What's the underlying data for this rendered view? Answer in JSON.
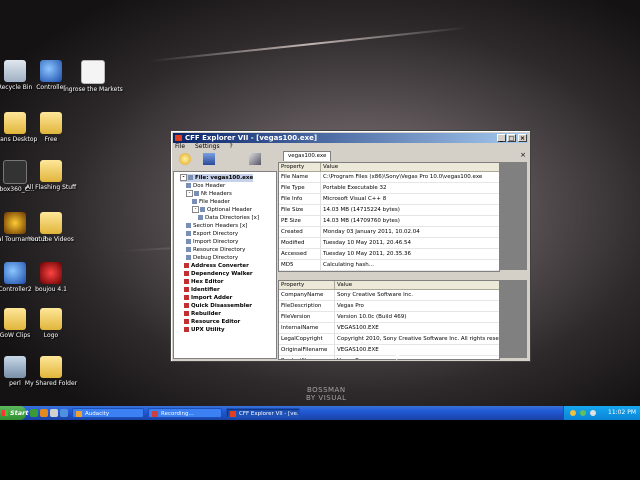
{
  "desktop": {
    "icons": [
      {
        "label": "Recycle Bin",
        "icon": "recycle-bin-icon",
        "cls": "g-bin"
      },
      {
        "label": "Controller",
        "icon": "controller-icon",
        "cls": "g-blue"
      },
      {
        "label": "Ingrose the Markets",
        "icon": "document-icon",
        "cls": "g-file"
      },
      {
        "label": "Seans Desktop",
        "icon": "folder-icon",
        "cls": "g-folder"
      },
      {
        "label": "Free",
        "icon": "folder-icon",
        "cls": "g-folder"
      },
      {
        "label": "Xbox360_C...",
        "icon": "game-icon",
        "cls": "g-dark"
      },
      {
        "label": "All Flashing Stuff",
        "icon": "folder-icon",
        "cls": "g-folder"
      },
      {
        "label": "Unreal Tournament 3",
        "icon": "game-icon",
        "cls": "g-game"
      },
      {
        "label": "Youtube Videos",
        "icon": "folder-icon",
        "cls": "g-folder"
      },
      {
        "label": "Controller2",
        "icon": "controller-icon",
        "cls": "g-blue"
      },
      {
        "label": "boujou 4.1",
        "icon": "boujou-icon",
        "cls": "g-red"
      },
      {
        "label": "GoW Clips",
        "icon": "folder-icon",
        "cls": "g-folder"
      },
      {
        "label": "Logo",
        "icon": "folder-icon",
        "cls": "g-folder"
      },
      {
        "label": "perl",
        "icon": "computer-icon",
        "cls": "g-pc"
      },
      {
        "label": "My Shared Folder",
        "icon": "folder-icon",
        "cls": "g-folder"
      }
    ],
    "watermark_line1": "BOSSMAN",
    "watermark_line2": "BY VISUAL"
  },
  "window": {
    "title": "CFF Explorer VII - [vegas100.exe]",
    "menu": [
      "File",
      "Settings",
      "?"
    ],
    "tab_label": "vegas100.exe",
    "tree": [
      {
        "label": "File: vegas100.exe",
        "bold": true,
        "sel": true
      },
      {
        "label": "Dos Header"
      },
      {
        "label": "Nt Headers"
      },
      {
        "label": "File Header"
      },
      {
        "label": "Optional Header"
      },
      {
        "label": "Data Directories [x]"
      },
      {
        "label": "Section Headers [x]"
      },
      {
        "label": "Export Directory"
      },
      {
        "label": "Import Directory"
      },
      {
        "label": "Resource Directory"
      },
      {
        "label": "Debug Directory"
      },
      {
        "label": "Address Converter",
        "bold": true
      },
      {
        "label": "Dependency Walker",
        "bold": true
      },
      {
        "label": "Hex Editor",
        "bold": true
      },
      {
        "label": "Identifier",
        "bold": true
      },
      {
        "label": "Import Adder",
        "bold": true
      },
      {
        "label": "Quick Disassembler",
        "bold": true
      },
      {
        "label": "Rebuilder",
        "bold": true
      },
      {
        "label": "Resource Editor",
        "bold": true
      },
      {
        "label": "UPX Utility",
        "bold": true
      }
    ],
    "top_grid": {
      "headers": [
        "Property",
        "Value"
      ],
      "rows": [
        [
          "File Name",
          "C:\\Program Files (x86)\\Sony\\Vegas Pro 10.0\\vegas100.exe"
        ],
        [
          "File Type",
          "Portable Executable 32"
        ],
        [
          "File Info",
          "Microsoft Visual C++ 8"
        ],
        [
          "File Size",
          "14.03 MB (14715224 bytes)"
        ],
        [
          "PE Size",
          "14.03 MB (14709760 bytes)"
        ],
        [
          "Created",
          "Monday 03 January 2011, 10.02.04"
        ],
        [
          "Modified",
          "Tuesday 10 May 2011, 20.46.54"
        ],
        [
          "Accessed",
          "Tuesday 10 May 2011, 20.35.36"
        ],
        [
          "MD5",
          "Calculating hash..."
        ],
        [
          "SHA-1",
          "Calculating hash..."
        ]
      ]
    },
    "bottom_grid": {
      "headers": [
        "Property",
        "Value"
      ],
      "rows": [
        [
          "CompanyName",
          "Sony Creative Software Inc."
        ],
        [
          "FileDescription",
          "Vegas Pro"
        ],
        [
          "FileVersion",
          "Version 10.0c (Build 469)"
        ],
        [
          "InternalName",
          "VEGAS100.EXE"
        ],
        [
          "LegalCopyright",
          "Copyright 2010, Sony Creative Software Inc. All rights reserved."
        ],
        [
          "OriginalFilename",
          "VEGAS100.EXE"
        ],
        [
          "ProductName",
          "Vegas Pro"
        ]
      ]
    }
  },
  "taskbar": {
    "start_label": "Start",
    "tasks": [
      {
        "label": "Audacity",
        "active": false
      },
      {
        "label": "Recording...",
        "active": false
      },
      {
        "label": "CFF Explorer VII - [ve...",
        "active": true
      }
    ],
    "clock": "11:02 PM"
  },
  "colors": {
    "title_start": "#0a246a",
    "title_end": "#a6caf0",
    "taskbar": "#245edb",
    "selection": "#c7d2ea"
  }
}
